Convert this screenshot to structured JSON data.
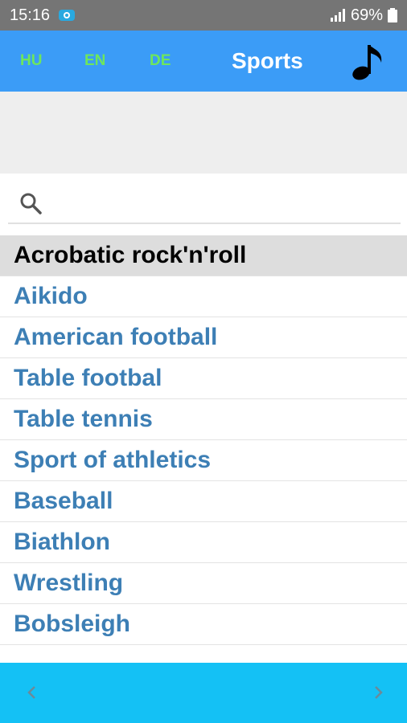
{
  "status_bar": {
    "time": "15:16",
    "battery": "69%"
  },
  "header": {
    "languages": [
      "HU",
      "EN",
      "DE"
    ],
    "title": "Sports"
  },
  "search": {
    "placeholder": ""
  },
  "list": {
    "items": [
      "Acrobatic rock'n'roll",
      "Aikido",
      "American football",
      "Table footbal",
      "Table tennis",
      "Sport of athletics",
      "Baseball",
      "Biathlon",
      "Wrestling",
      "Bobsleigh"
    ]
  },
  "icons": [
    "camera-icon",
    "signal-icon",
    "battery-icon",
    "music-note-icon",
    "search-icon",
    "chevron-left-icon",
    "chevron-right-icon"
  ],
  "colors": {
    "header": "#3b9cf7",
    "language": "#6ee65c",
    "footer": "#14c1f5",
    "item_text": "#3d7fb5"
  }
}
